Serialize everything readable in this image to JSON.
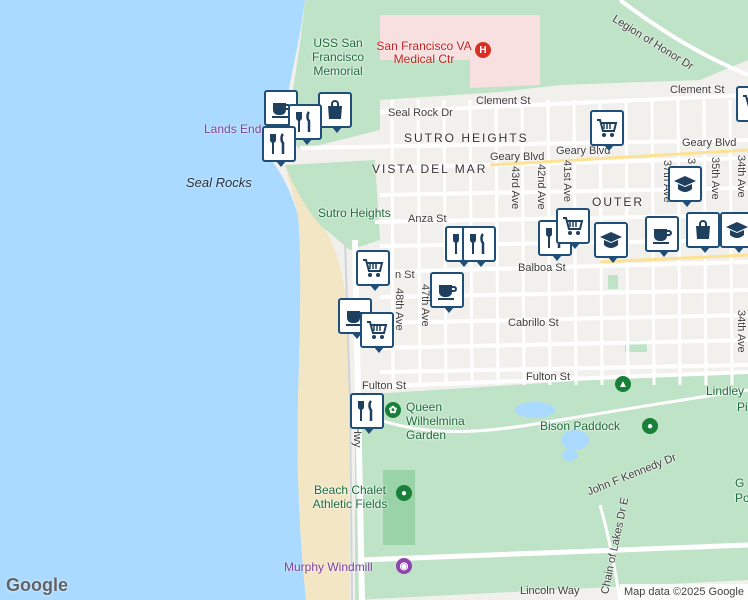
{
  "colors": {
    "water": "#aadaff",
    "park": "#bfe3c7",
    "land": "#f2f0ec",
    "beach": "#f3e6c4",
    "hospital": "#f8dfe0",
    "marker_border": "#1f4e79",
    "road": "#ffffff",
    "highway": "#fde293"
  },
  "streets": {
    "legion_of_honor": "Legion of Honor Dr",
    "clement_st_1": "Clement St",
    "clement_st_2": "Clement St",
    "seal_rock_dr": "Seal Rock Dr",
    "geary_blvd_1": "Geary Blvd",
    "geary_blvd_2": "Geary Blvd",
    "geary_blvd_3": "Geary Blvd",
    "anza_st": "Anza St",
    "balboa_st_1": "n St",
    "balboa_st_2": "Balboa St",
    "cabrillo_st": "Cabrillo St",
    "fulton_st_1": "Fulton St",
    "fulton_st_2": "Fulton St",
    "jfk_dr": "John F Kennedy Dr",
    "lincoln_way": "Lincoln Way",
    "chain_of_lakes": "Chain of Lakes Dr E",
    "great_hwy": "t Hwy",
    "ave_48": "48th Ave",
    "ave_47": "47th Ave",
    "ave_43": "43rd Ave",
    "ave_42": "42nd Ave",
    "ave_41": "41st Ave",
    "ave_37": "37th Ave",
    "ave_35": "35th Ave",
    "ave_34": "34th Ave",
    "ave_34b": "34th Ave",
    "ave_3x": "3"
  },
  "neighborhoods": {
    "sutro_heights_top": "SUTRO HEIGHTS",
    "vista_del_mar": "VISTA DEL MAR",
    "outer": "OUTER"
  },
  "places": {
    "uss_sf_memorial": "USS San Francisco Memorial",
    "va_medical": "San Francisco VA Medical Ctr",
    "lands_end": "Lands End",
    "seal_rocks": "Seal Rocks",
    "sutro_heights": "Sutro Heights",
    "queen_wilhelmina": "Queen Wilhelmina Garden",
    "bison_paddock": "Bison Paddock",
    "beach_chalet": "Beach Chalet Athletic Fields",
    "murphy_windmill": "Murphy Windmill",
    "lindley": "Lindley",
    "lindley_2": "Pi",
    "golden_gate": "G",
    "golden_gate_2": "Po"
  },
  "markers": [
    {
      "icon": "coffee-icon"
    },
    {
      "icon": "shopping-bag-icon"
    },
    {
      "icon": "restaurant-icon"
    },
    {
      "icon": "restaurant-icon"
    },
    {
      "icon": "shopping-cart-icon"
    },
    {
      "icon": "shopping-cart-icon"
    },
    {
      "icon": "restaurant-icon"
    },
    {
      "icon": "coffee-icon"
    },
    {
      "icon": "coffee-icon"
    },
    {
      "icon": "shopping-cart-icon"
    },
    {
      "icon": "restaurant-icon"
    },
    {
      "icon": "restaurant-icon"
    },
    {
      "icon": "shopping-cart-icon"
    },
    {
      "icon": "school-icon"
    },
    {
      "icon": "coffee-icon"
    },
    {
      "icon": "school-icon"
    },
    {
      "icon": "shopping-bag-icon"
    },
    {
      "icon": "school-icon"
    },
    {
      "icon": "shopping-cart-icon"
    },
    {
      "icon": "restaurant-icon"
    }
  ],
  "attribution": {
    "logo": "Google",
    "text": "Map data ©2025 Google"
  }
}
